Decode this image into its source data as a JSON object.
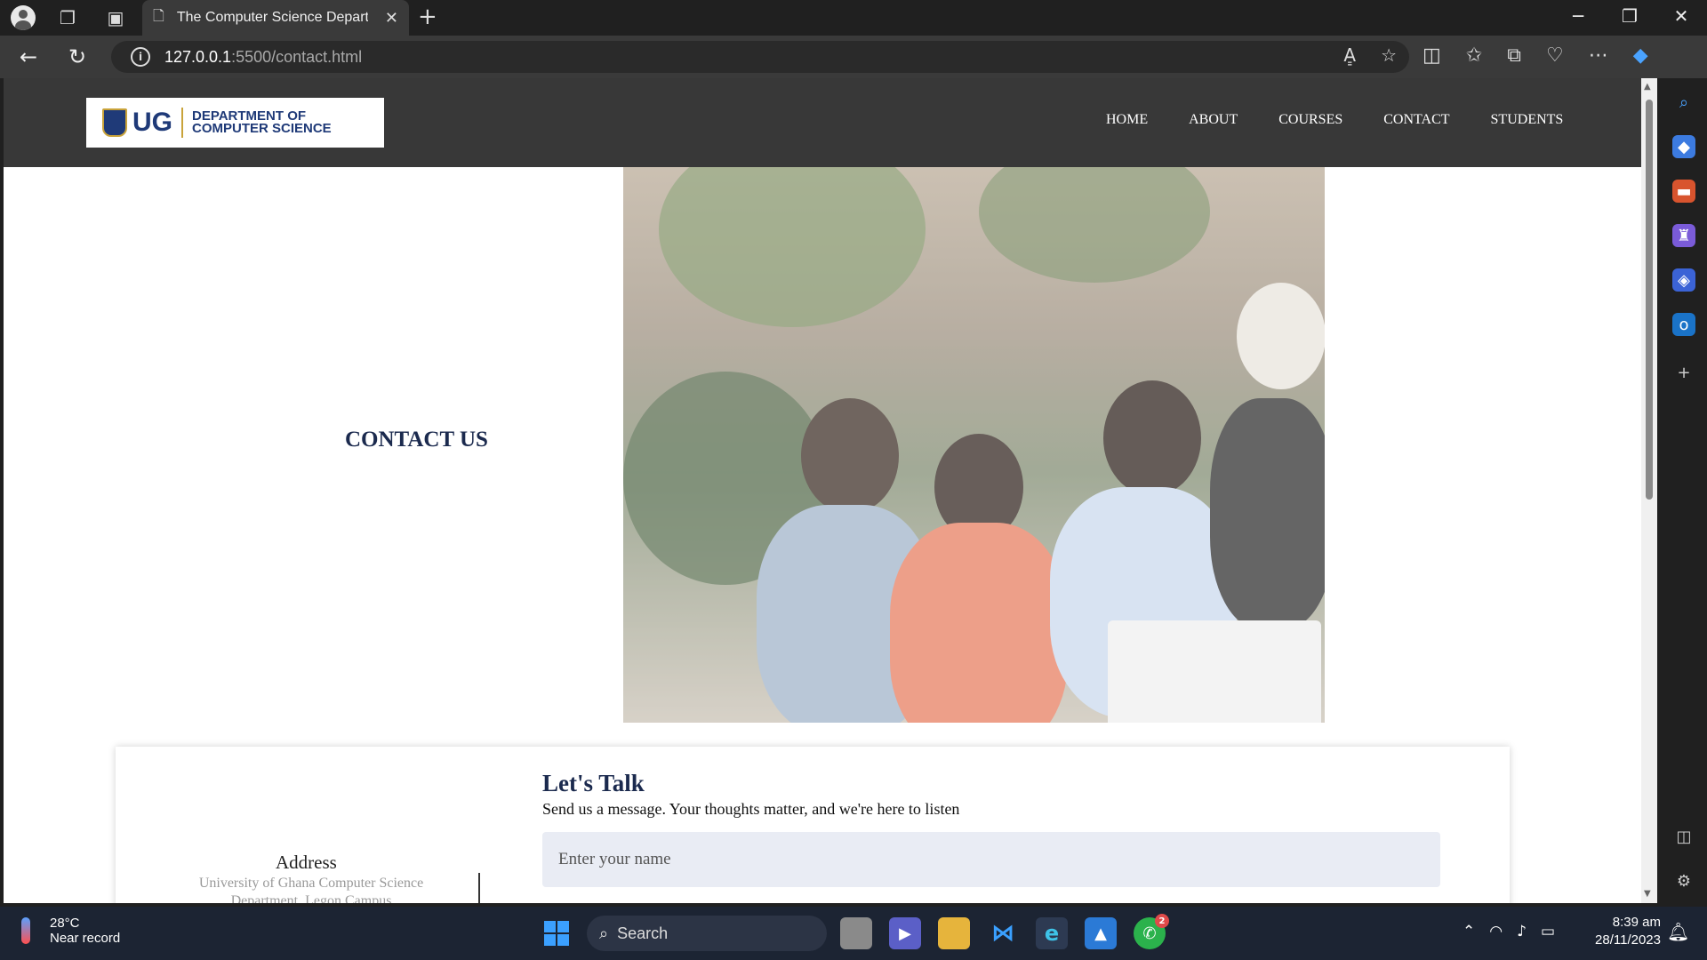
{
  "browser": {
    "tab_title": "The Computer Science Departme",
    "url_host": "127.0.0.1",
    "url_path": ":5500/contact.html",
    "read_aloud": "A͇"
  },
  "site": {
    "logo_short": "UG",
    "logo_line1": "DEPARTMENT OF",
    "logo_line2": "COMPUTER SCIENCE",
    "nav": [
      "HOME",
      "ABOUT",
      "COURSES",
      "CONTACT",
      "STUDENTS"
    ],
    "hero_title": "CONTACT US"
  },
  "contact": {
    "talk_title": "Let's Talk",
    "talk_subtitle": "Send us a message. Your thoughts matter, and we're here to listen",
    "name_placeholder": "Enter your name",
    "address_title": "Address",
    "address_line1": "University of Ghana Computer Science",
    "address_line2": "Department, Legon Campus"
  },
  "taskbar": {
    "temperature": "28°C",
    "weather_desc": "Near record",
    "search_label": "Search",
    "whatsapp_badge": "2",
    "time": "8:39 am",
    "date": "28/11/2023"
  },
  "colors": {
    "brand_navy": "#1b2a4e",
    "header_bg": "#383838",
    "ug_blue": "#1f3a78",
    "ug_gold": "#c9a33a"
  }
}
